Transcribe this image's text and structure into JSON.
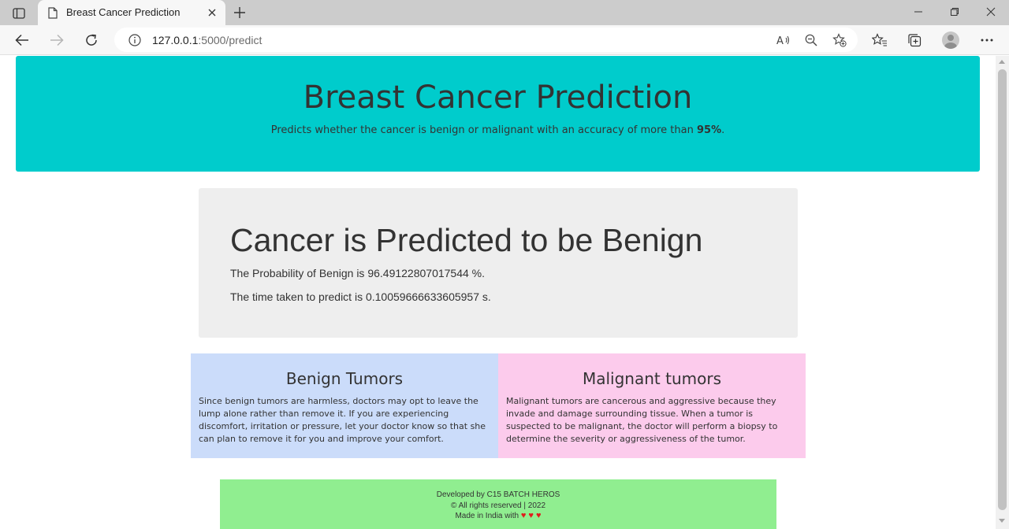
{
  "browser": {
    "tab_title": "Breast Cancer Prediction",
    "url_host": "127.0.0.1",
    "url_rest": ":5000/predict",
    "icons": [
      "tab-actions-icon",
      "page-icon",
      "close-icon",
      "plus-icon",
      "minimize-icon",
      "restore-icon",
      "close-window-icon",
      "back-arrow-icon",
      "forward-arrow-icon",
      "refresh-icon",
      "info-icon",
      "read-aloud-icon",
      "zoom-out-icon",
      "add-favorite-icon",
      "favorites-icon",
      "collections-icon",
      "profile-avatar",
      "more-icon"
    ]
  },
  "header": {
    "title": "Breast Cancer Prediction",
    "subtitle": "Predicts whether the cancer is benign or malignant with an accuracy of more than",
    "accuracy": "95%",
    "end": ".",
    "color": "#00cccc"
  },
  "result": {
    "heading": "Cancer is Predicted to be Benign",
    "probability_line": "The Probability of Benign is 96.49122807017544 %.",
    "time_line": "The time taken to predict is 0.10059666633605957 s."
  },
  "benign": {
    "title": "Benign Tumors",
    "text": "Since benign tumors are harmless, doctors may opt to leave the lump alone rather than remove it. If you are experiencing discomfort, irritation or pressure, let your doctor know so that she can plan to remove it for you and improve your comfort.",
    "color": "#cbdcfa"
  },
  "malignant": {
    "title": "Malignant tumors",
    "text": "Malignant tumors are cancerous and aggressive because they invade and damage surrounding tissue. When a tumor is suspected to be malignant, the doctor will perform a biopsy to determine the severity or aggressiveness of the tumor.",
    "color": "#fccbec"
  },
  "footer": {
    "developed": "Developed by C15 BATCH HEROS",
    "rights": "© All rights reserved | 2022",
    "made": "Made in India with",
    "hearts": "♥ ♥ ♥",
    "color": "#90ee90"
  }
}
